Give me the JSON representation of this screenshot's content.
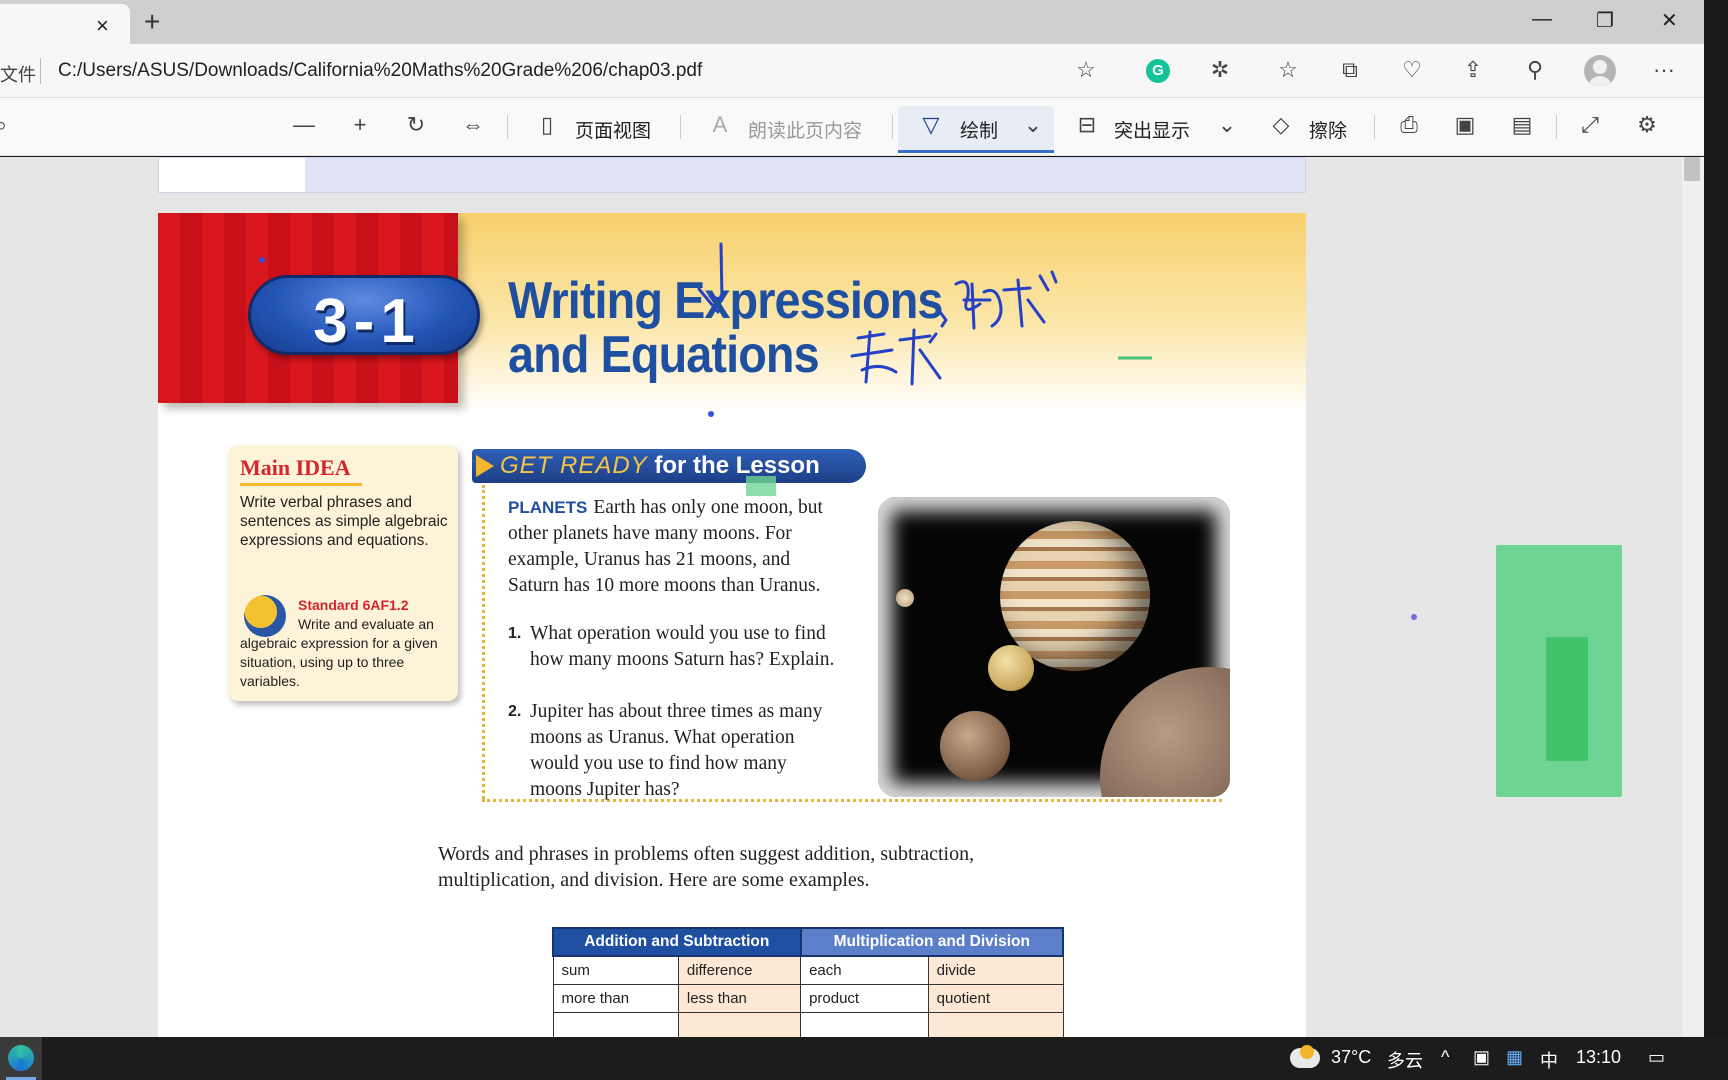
{
  "browser": {
    "tab_close": "×",
    "new_tab": "+",
    "window_controls": {
      "minimize": "—",
      "restore": "❐",
      "close": "✕"
    },
    "address_prefix": "文件",
    "url": "C:/Users/ASUS/Downloads/California%20Maths%20Grade%206/chap03.pdf",
    "extension_badge": "G",
    "icons": [
      "favorite-add-icon",
      "grammarly-icon",
      "extensions-icon",
      "favorites-icon",
      "collections-icon",
      "browser-essentials-icon",
      "share-icon",
      "profile-sync-icon",
      "avatar",
      "more-icon"
    ],
    "more": "···"
  },
  "pdf_toolbar": {
    "search_glyph": "⌕",
    "zoom_out": "—",
    "zoom_in": "+",
    "page_view_label": "页面视图",
    "read_aloud_label": "朗读此页内容",
    "draw_label": "绘制",
    "highlight_label": "突出显示",
    "erase_label": "擦除",
    "dropdown": "⌄"
  },
  "page": {
    "lesson_number": "3-1",
    "title_line1": "Writing Expressions",
    "title_line2": "and Equations",
    "main_idea": {
      "title": "Main IDEA",
      "text": "Write verbal phrases and sentences as simple algebraic expressions and equations.",
      "standard_code": "Standard 6AF1.2",
      "standard_text": "Write and evaluate an algebraic expression for a given situation, using up to three variables."
    },
    "get_ready": {
      "highlight": "GET READY",
      "rest": "for the Lesson"
    },
    "story": {
      "lead": "PLANETS",
      "text": "Earth has only one moon, but other planets have many moons. For example, Uranus has 21 moons, and Saturn has 10 more moons than Uranus."
    },
    "questions": [
      {
        "num": "1.",
        "text": "What operation would you use to find how many moons Saturn has? Explain."
      },
      {
        "num": "2.",
        "text": "Jupiter has about three times as many moons as Uranus. What operation would you use to find how many moons Jupiter has?"
      }
    ],
    "body": "Words and phrases in problems often suggest addition, subtraction, multiplication, and division. Here are some examples.",
    "table": {
      "headers": [
        "Addition and Subtraction",
        "Multiplication and Division"
      ],
      "rows": [
        [
          "sum",
          "difference",
          "each",
          "divide"
        ],
        [
          "more than",
          "less than",
          "product",
          "quotient"
        ]
      ]
    }
  },
  "taskbar": {
    "temperature": "37°C",
    "weather": "多云",
    "chevron": "^",
    "ime": "中",
    "time": "13:10"
  }
}
